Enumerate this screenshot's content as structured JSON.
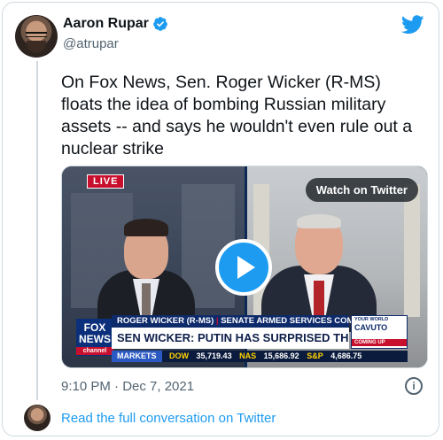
{
  "author": {
    "name": "Aaron Rupar",
    "handle": "@atrupar",
    "verified": true
  },
  "tweet": {
    "text": "On Fox News, Sen. Roger Wicker (R-MS) floats the idea of bombing Russian military assets -- and says he wouldn't even rule out a nuclear strike",
    "timestamp": "9:10 PM · Dec 7, 2021"
  },
  "media": {
    "live_badge": "LIVE",
    "watch_label": "Watch on Twitter",
    "chyron_top_name": "ROGER WICKER (R-MS)",
    "chyron_top_role": "SENATE ARMED SERVICES COMMITTEE",
    "chyron_main": "SEN WICKER: PUTIN HAS SURPRISED THE WEST TWICE",
    "network_logo": "FOX NEWS",
    "network_sub": "channel",
    "show_world": "YOUR WORLD",
    "show_name": "CAVUTO",
    "show_coming": "COMING UP",
    "ticker": {
      "markets": "MARKETS",
      "dow_label": "DOW",
      "dow_value": "35,719.43",
      "nas_label": "NAS",
      "nas_value": "15,686.92",
      "sp_label": "S&P",
      "sp_value": "4,686.75"
    }
  },
  "footer": {
    "read_more": "Read the full conversation on Twitter"
  },
  "colors": {
    "twitter_blue": "#1d9bf0",
    "text_primary": "#0f1419",
    "text_secondary": "#536471",
    "border": "#cfd9de"
  },
  "icons": {
    "brand": "twitter-bird-icon",
    "verified": "verified-badge-icon",
    "play": "play-icon",
    "info": "info-icon"
  }
}
